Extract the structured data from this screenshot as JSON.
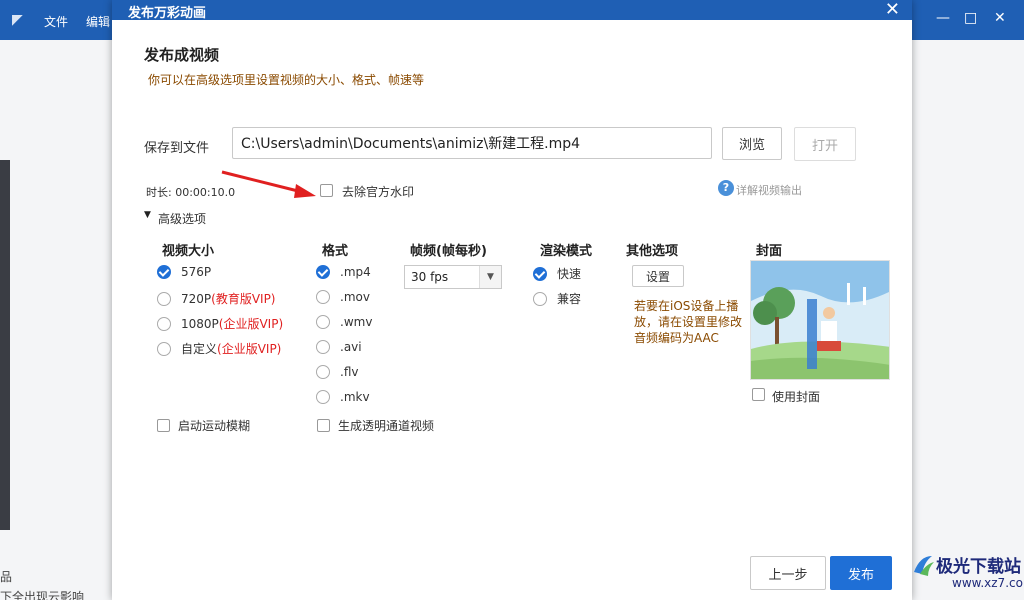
{
  "app": {
    "menu": [
      "文件",
      "编辑"
    ],
    "win_controls": [
      "—",
      "□",
      "✕"
    ],
    "left_fragments": [
      "品",
      "下全出现云影响"
    ]
  },
  "dialog": {
    "title": "发布万彩动画",
    "close_glyph": "✕",
    "heading": "发布成视频",
    "subheading": "你可以在高级选项里设置视频的大小、格式、帧速等",
    "save_label": "保存到文件",
    "save_path": "C:\\Users\\admin\\Documents\\animiz\\新建工程.mp4",
    "browse_label": "浏览",
    "open_label": "打开",
    "duration_text": "时长: 00:00:10.0",
    "watermark_label": "去除官方水印",
    "help_label": "详解视频输出",
    "advanced_label": "高级选项"
  },
  "columns": {
    "size": {
      "header": "视频大小",
      "options": [
        {
          "label": "576P",
          "vip": "",
          "selected": true
        },
        {
          "label": "720P",
          "vip": "(教育版VIP)",
          "selected": false
        },
        {
          "label": "1080P",
          "vip": "(企业版VIP)",
          "selected": false
        },
        {
          "label": "自定义",
          "vip": "(企业版VIP)",
          "selected": false
        }
      ],
      "motion_blur_label": "启动运动模糊"
    },
    "format": {
      "header": "格式",
      "options": [
        ".mp4",
        ".mov",
        ".wmv",
        ".avi",
        ".flv",
        ".mkv"
      ],
      "selected": ".mp4",
      "alpha_label": "生成透明通道视频"
    },
    "fps": {
      "header": "帧频(帧每秒)",
      "value": "30 fps"
    },
    "render": {
      "header": "渲染模式",
      "options": [
        "快速",
        "兼容"
      ],
      "selected": "快速"
    },
    "other": {
      "header": "其他选项",
      "settings_label": "设置",
      "note": "若要在iOS设备上播放，请在设置里修改音频编码为AAC"
    },
    "cover": {
      "header": "封面",
      "use_cover_label": "使用封面"
    }
  },
  "footer": {
    "prev_label": "上一步",
    "publish_label": "发布"
  },
  "watermark_badge": {
    "text": "极光下载站",
    "url": "www.xz7.com"
  },
  "colors": {
    "titlebar": "#1f5fb4",
    "primary": "#1f6fd6",
    "vip": "#e02020",
    "note": "#8a4a00"
  }
}
